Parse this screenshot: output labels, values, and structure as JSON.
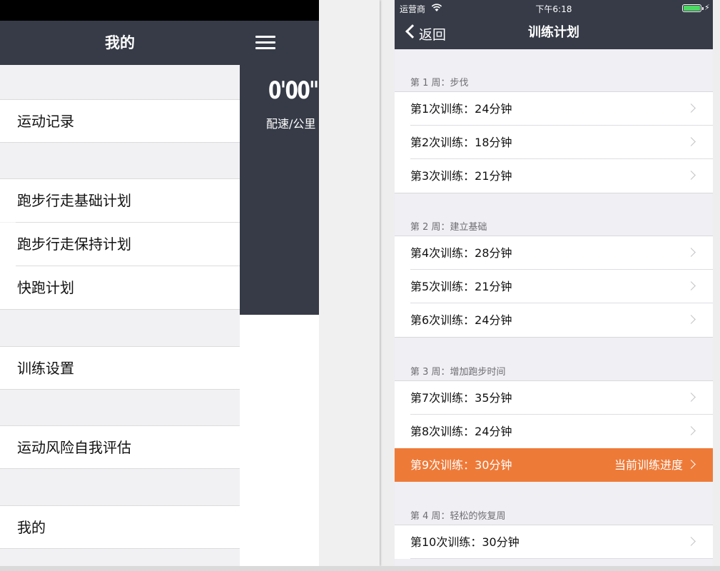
{
  "left": {
    "nav_title": "我的",
    "pace_value": "0'00\"",
    "pace_label": "配速/公里",
    "menu": [
      {
        "label": "运动记录"
      },
      {
        "label": "跑步行走基础计划"
      },
      {
        "label": "跑步行走保持计划"
      },
      {
        "label": "快跑计划"
      },
      {
        "label": "训练设置"
      },
      {
        "label": "运动风险自我评估"
      },
      {
        "label": "我的"
      }
    ]
  },
  "right": {
    "status": {
      "carrier": "运营商",
      "time": "下午6:18"
    },
    "nav": {
      "back": "返回",
      "title": "训练计划"
    },
    "sections": [
      {
        "header": "第 1 周：步伐",
        "rows": [
          {
            "label": "第1次训练：24分钟"
          },
          {
            "label": "第2次训练：18分钟"
          },
          {
            "label": "第3次训练：21分钟"
          }
        ]
      },
      {
        "header": "第 2 周：建立基础",
        "rows": [
          {
            "label": "第4次训练：28分钟"
          },
          {
            "label": "第5次训练：21分钟"
          },
          {
            "label": "第6次训练：24分钟"
          }
        ]
      },
      {
        "header": "第 3 周：增加跑步时间",
        "rows": [
          {
            "label": "第7次训练：35分钟"
          },
          {
            "label": "第8次训练：24分钟"
          },
          {
            "label": "第9次训练：30分钟",
            "status": "当前训练进度"
          }
        ]
      },
      {
        "header": "第 4 周：轻松的恢复周",
        "rows": [
          {
            "label": "第10次训练：30分钟"
          }
        ]
      }
    ]
  },
  "colors": {
    "nav_bg": "#363b47",
    "highlight": "#ee7a38",
    "battery": "#4cd964"
  }
}
